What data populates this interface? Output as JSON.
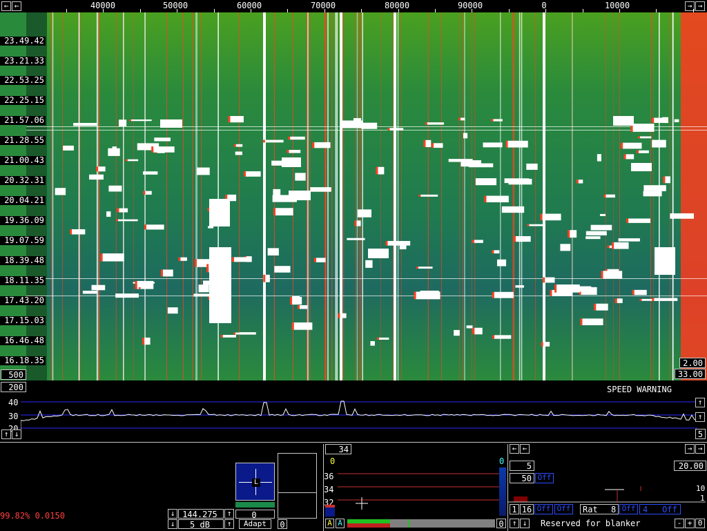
{
  "freq_axis": {
    "labels": [
      "40000",
      "50000",
      "60000",
      "70000",
      "80000",
      "90000",
      "0",
      "10000"
    ],
    "left_arrow": "←",
    "right_arrow": "→",
    "far_left_arrow": "←",
    "far_right_arrow": "→"
  },
  "waterfall": {
    "time_labels": [
      "23.49.42",
      "23.21.33",
      "22.53.25",
      "22.25.15",
      "21.57.06",
      "21.28.55",
      "21.00.43",
      "20.32.31",
      "20.04.21",
      "19.36.09",
      "19.07.59",
      "18.39.48",
      "18.11.35",
      "17.43.20",
      "17.15.03",
      "16.46.48",
      "16.18.35"
    ],
    "bottom_left_value": "500",
    "right_top_value": "2.00",
    "right_bottom_value": "33.00",
    "colors": {
      "background": "#2a8a3c",
      "signal": "#ffffff",
      "trace": "#ff3b1f",
      "deep": "#1f6a5a"
    }
  },
  "spectrum": {
    "left_value": "200",
    "speed_warning": "SPEED WARNING",
    "y_labels": [
      "40",
      "30",
      "20"
    ],
    "up_arrow": "↑",
    "down_arrow": "↓",
    "right_value": "5",
    "colors": {
      "grid": "#2d2dff",
      "trace": "#ffffff"
    }
  },
  "status": {
    "percent_text": "99.82% 0.0150",
    "color": "#ff4040"
  },
  "freq_control": {
    "frequency": "144.275",
    "gain": "5 dB",
    "up": "↑",
    "down": "↓"
  },
  "squelch": {
    "marker": "L",
    "value": "0",
    "adapt_label": "Adapt",
    "side_value": "0"
  },
  "afc": {
    "top_value": "34",
    "left_zero": "0",
    "right_zero": "0",
    "y_labels": [
      "36",
      "34",
      "32"
    ],
    "a_buttons": [
      "A",
      "A"
    ],
    "bottom_right": "0"
  },
  "blanker": {
    "arrows": [
      "←",
      "←",
      "→",
      "→"
    ],
    "value_5": "5",
    "value_20": "20.00",
    "value_50": "50",
    "off_labels": [
      "Off",
      "Off",
      "Off",
      "Off",
      "Off"
    ],
    "right_scale": [
      "10",
      "1"
    ],
    "ctrl_1": "1",
    "ctrl_16": "16",
    "rat_label": "Rat",
    "rat_value": "8",
    "ctrl_4": "4",
    "reserved_text": "Reserved for blanker",
    "minus": "-",
    "plus": "+",
    "zero": "0"
  }
}
